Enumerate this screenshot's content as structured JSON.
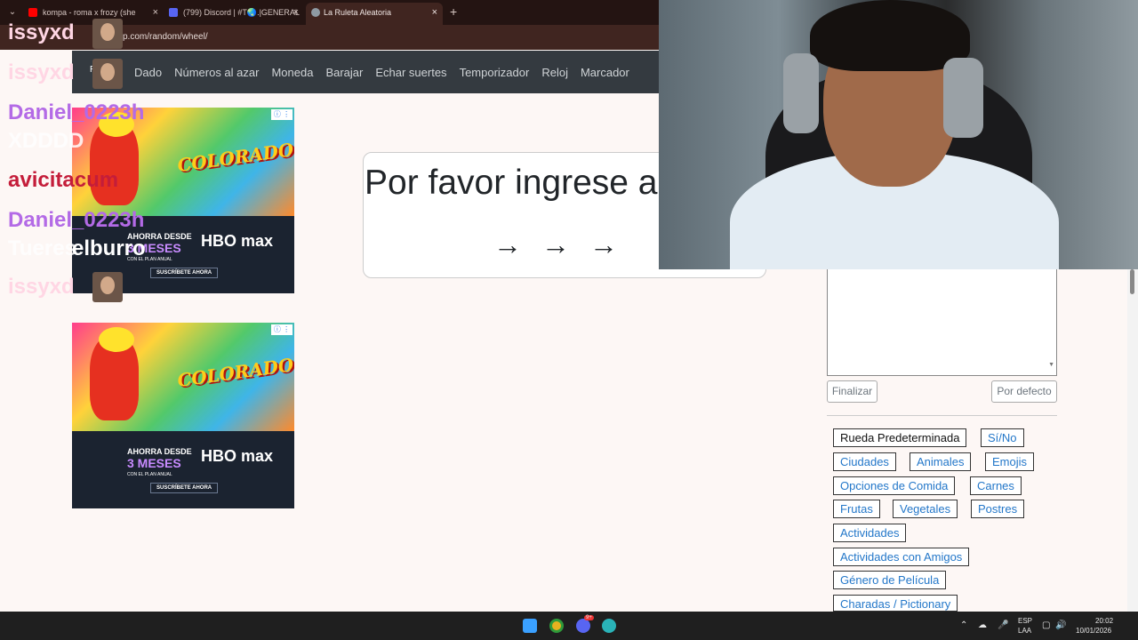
{
  "browser": {
    "tabs": [
      {
        "title": "kompa - roma x frozy (she",
        "favicon_color": "#ff0000"
      },
      {
        "title": "(799) Discord | #T🌏.|GENERAL |",
        "favicon_color": "#5865f2"
      },
      {
        "title": "La Ruleta Aleatoria",
        "favicon_color": "#8e9aa3"
      }
    ],
    "new_tab": "+",
    "close": "×",
    "url": "p.com/random/wheel/"
  },
  "navbar": {
    "brand": "R",
    "links": [
      "Dado",
      "Números al azar",
      "Moneda",
      "Barajar",
      "Echar suertes",
      "Temporizador",
      "Reloj",
      "Marcador"
    ]
  },
  "ad": {
    "logo": "COLORADO",
    "line1": "AHORRA DESDE",
    "line2": "3 MESES",
    "line3": "CON EL PLAN ANUAL",
    "brand": "HBO max",
    "cta": "SUSCRÍBETE AHORA",
    "info": "ⓘ ⋮"
  },
  "card": {
    "title": "Por favor ingrese a",
    "arrows": "→→→"
  },
  "panel": {
    "finish_label": "Finalizar",
    "default_label": "Por defecto",
    "wheels": [
      "Rueda Predeterminada",
      "Sí/No",
      "Ciudades",
      "Animales",
      "Emojis",
      "Opciones de Comida",
      "Carnes",
      "Frutas",
      "Vegetales",
      "Postres",
      "Actividades",
      "Actividades con Amigos",
      "Género de Película",
      "Charadas / Pictionary"
    ]
  },
  "chat": [
    {
      "user": "issyxd",
      "color": "#ffd6e4"
    },
    {
      "user": "issyxd",
      "color": "#ffd6e4"
    },
    {
      "user": "Daniel_0223h",
      "color": "#b36ae6"
    },
    {
      "user": "XDDDD",
      "color": "#ffffff"
    },
    {
      "user": "avicitacum",
      "color": "#c41d3a"
    },
    {
      "user": "Daniel_0223h",
      "color": "#b36ae6"
    },
    {
      "user": "Tueres",
      "color": "#ffffff"
    },
    {
      "user": "elburro",
      "color": "#ffffff"
    },
    {
      "user": "issyxd",
      "color": "#ffd6e4"
    }
  ],
  "taskbar": {
    "lang1": "ESP",
    "lang2": "LAA",
    "time": "20:02",
    "date": "10/01/2026",
    "discord_badge": "9+"
  }
}
